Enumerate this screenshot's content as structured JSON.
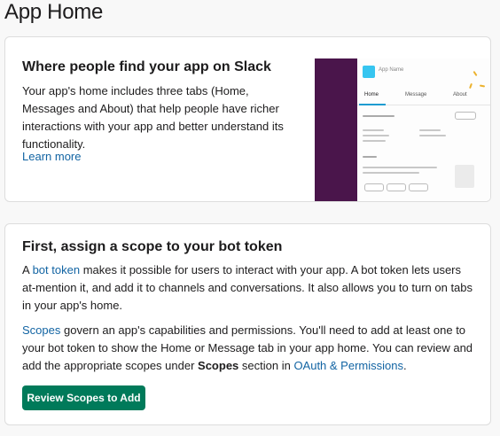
{
  "page": {
    "title": "App Home"
  },
  "home_card": {
    "heading": "Where people find your app on Slack",
    "description": "Your app's home includes three tabs (Home, Messages and About) that help people have richer interactions with your app and better understand its functionality.",
    "learn_more": "Learn more",
    "preview": {
      "app_name": "App Name",
      "tabs": [
        "Home",
        "Message",
        "About"
      ],
      "colors": {
        "sidebar": "#4a154b",
        "app_icon": "#36c5f0",
        "tab_underline": "#1d9bd1",
        "sparkle": "#ecb22e"
      }
    }
  },
  "scope_card": {
    "heading": "First, assign a scope to your bot token",
    "para1": {
      "prefix": "A ",
      "link": "bot token",
      "suffix": " makes it possible for users to interact with your app. A bot token lets users at-mention it, and add it to channels and conversations. It also allows you to turn on tabs in your app's home."
    },
    "para2": {
      "link1": "Scopes",
      "text1": " govern an app's capabilities and permissions. You'll need to add at least one to your bot token to show the Home or Message tab in your app home. You can review and add the appropriate scopes under ",
      "bold": "Scopes",
      "text2": " section in ",
      "link2": "OAuth & Permissions",
      "text3": "."
    },
    "button_label": "Review Scopes to Add",
    "colors": {
      "button": "#007a5a",
      "link": "#1264a3"
    }
  }
}
